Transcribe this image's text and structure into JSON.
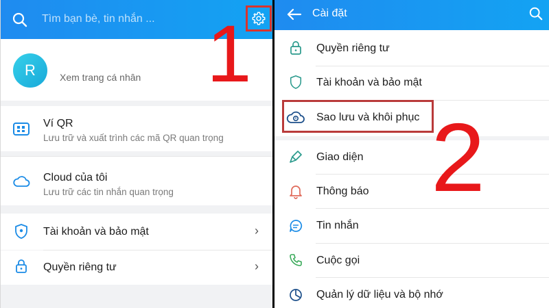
{
  "left_screen": {
    "search": {
      "placeholder": "Tìm bạn bè, tin nhắn ..."
    },
    "profile": {
      "avatar_initial": "R",
      "link": "Xem trang cá nhân"
    },
    "items": [
      {
        "title": "Ví QR",
        "subtitle": "Lưu trữ và xuất trình các mã QR quan trọng"
      },
      {
        "title": "Cloud của tôi",
        "subtitle": "Lưu trữ các tin nhắn quan trọng"
      },
      {
        "title": "Tài khoản và bảo mật"
      },
      {
        "title": "Quyền riêng tư"
      }
    ],
    "step_label": "1"
  },
  "right_screen": {
    "title": "Cài đặt",
    "items": [
      {
        "label": "Quyền riêng tư",
        "icon": "lock-icon"
      },
      {
        "label": "Tài khoản và bảo mật",
        "icon": "shield-icon"
      },
      {
        "label": "Sao lưu và khôi phục",
        "icon": "cloud-backup-icon"
      },
      {
        "label": "Giao diện",
        "icon": "brush-icon"
      },
      {
        "label": "Thông báo",
        "icon": "bell-icon"
      },
      {
        "label": "Tin nhắn",
        "icon": "chat-icon"
      },
      {
        "label": "Cuộc gọi",
        "icon": "phone-icon"
      },
      {
        "label": "Quản lý dữ liệu và bộ nhớ",
        "icon": "pie-chart-icon"
      }
    ],
    "step_label": "2"
  },
  "colors": {
    "appbar_start": "#1f8bf0",
    "appbar_end": "#13a3f3",
    "icon_blue": "#1a8be6",
    "annotation_red": "#e8181a"
  }
}
